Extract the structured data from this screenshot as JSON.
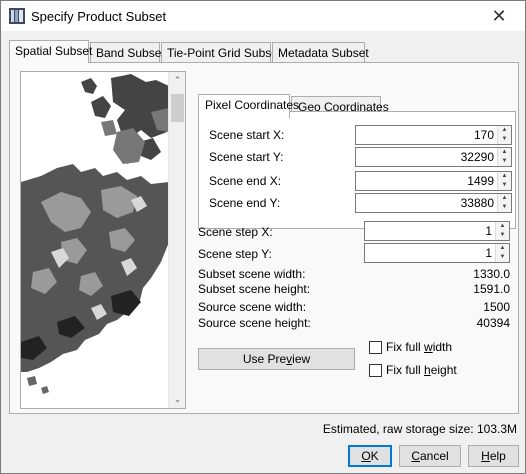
{
  "window": {
    "title": "Specify Product Subset",
    "close_glyph": "✕"
  },
  "tabs": [
    {
      "label": "Spatial Subset",
      "active": true
    },
    {
      "label": "Band Subset",
      "active": false
    },
    {
      "label": "Tie-Point Grid Subset",
      "active": false
    },
    {
      "label": "Metadata Subset",
      "active": false
    }
  ],
  "coord_tabs": [
    {
      "label": "Pixel Coordinates",
      "active": true
    },
    {
      "label": "Geo Coordinates",
      "active": false
    }
  ],
  "pixel": {
    "start_x_label": "Scene start X:",
    "start_x": "170",
    "start_y_label": "Scene start Y:",
    "start_y": "32290",
    "end_x_label": "Scene end X:",
    "end_x": "1499",
    "end_y_label": "Scene end Y:",
    "end_y": "33880"
  },
  "step": {
    "x_label": "Scene step X:",
    "x": "1",
    "y_label": "Scene step Y:",
    "y": "1"
  },
  "info": {
    "subset_width_label": "Subset scene width:",
    "subset_width": "1330.0",
    "subset_height_label": "Subset scene height:",
    "subset_height": "1591.0",
    "source_width_label": "Source scene width:",
    "source_width": "1500",
    "source_height_label": "Source scene height:",
    "source_height": "40394"
  },
  "preview_button": {
    "pre": "Use Pre",
    "mnemonic": "v",
    "post": "iew"
  },
  "fix_width": {
    "pre": "Fix full ",
    "mnemonic": "w",
    "post": "idth",
    "checked": false
  },
  "fix_height": {
    "pre": "Fix full ",
    "mnemonic": "h",
    "post": "eight",
    "checked": false
  },
  "storage": "Estimated, raw storage size: 103.3M",
  "buttons": {
    "ok": {
      "mnemonic": "O",
      "post": "K"
    },
    "cancel": {
      "mnemonic": "C",
      "post": "ancel"
    },
    "help": {
      "mnemonic": "H",
      "post": "elp"
    }
  },
  "icons": {
    "up": "▲",
    "down": "▼",
    "scroll_up": "⌃",
    "scroll_down": "⌄"
  },
  "colors": {
    "accent": "#0078d7",
    "panel": "#f0f0f0"
  }
}
